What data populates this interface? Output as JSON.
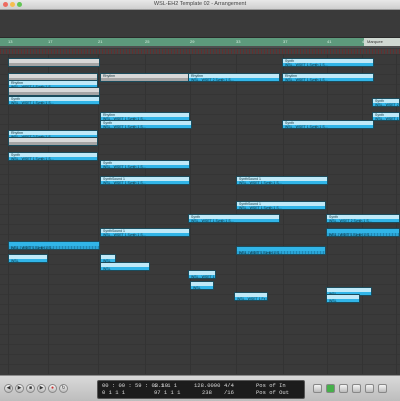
{
  "window": {
    "title": "WSL-EH2 Template 02 - Arrangement"
  },
  "ruler": {
    "bars": [
      "13",
      "17",
      "21",
      "25",
      "29",
      "33",
      "37",
      "41",
      "45",
      "49"
    ],
    "marquee_label": "Marquee"
  },
  "regions": [
    {
      "name": "",
      "body": "",
      "style": "grey"
    },
    {
      "name": "",
      "body": "",
      "style": "grey"
    },
    {
      "name": "Rhythm",
      "body": "WSL - WSET 1 Synth 1 S...",
      "style": "blue"
    },
    {
      "name": "",
      "body": "",
      "style": "grey"
    },
    {
      "name": "Rhythm",
      "body": "",
      "style": "grey"
    },
    {
      "name": "Rhythm",
      "body": "WSL - WSET 2 Synth 1 S...",
      "style": "blue"
    },
    {
      "name": "Rhythm",
      "body": "WSL - WSET 1 Synth 1 S...",
      "style": "blue"
    },
    {
      "name": "Synth",
      "body": "WSL - WSET 1 Synth 1 S...",
      "style": "blue"
    },
    {
      "name": "Synth",
      "body": "WSL - WSET 1 Synth 1 S...",
      "style": "blue"
    },
    {
      "name": "Rhythm",
      "body": "WSL - WSET 2 Synth 1 S...",
      "style": "blue"
    },
    {
      "name": "",
      "body": "",
      "style": "grey"
    },
    {
      "name": "Synth",
      "body": "WSL - WSET 1 Synth 1 S...",
      "style": "blue"
    },
    {
      "name": "Rhythm",
      "body": "WSL - WSET 1 Synth 1 S...",
      "style": "blue"
    },
    {
      "name": "Synth",
      "body": "WSL - WSET 1 Synth 1 S...",
      "style": "blue"
    },
    {
      "name": "Synth",
      "body": "WSL - WSET 1 Synth 1 S...",
      "style": "blue"
    },
    {
      "name": "Synth",
      "body": "WSL - WSET 2 Synth 1 S...",
      "style": "blue"
    },
    {
      "name": "Synth",
      "body": "WSL - WSET 1 Synth 1 S...",
      "style": "blue"
    },
    {
      "name": "Synth",
      "body": "WSL - WSET 1 Synth 1 S...",
      "style": "blue"
    },
    {
      "name": "SynthSound 1",
      "body": "WSL - WSET 1 Synth 1 S...",
      "style": "blue"
    },
    {
      "name": "SynthSound 1",
      "body": "WSL - WSET 1 Synth 1 S...",
      "style": "blue"
    },
    {
      "name": "SynthSound 1",
      "body": "WSL - WSET 1 Synth 1 S...",
      "style": "blue"
    },
    {
      "name": "SynthSound 1",
      "body": "WSL - WSET 1 Synth 1 S...",
      "style": "blue"
    },
    {
      "name": "Synth",
      "body": "WSL - WSET 1 Synth 1 S...",
      "style": "blue"
    },
    {
      "name": "Synth",
      "body": "WSL - WSET 2 Synth 1 S...",
      "style": "blue"
    },
    {
      "name": "",
      "body": "WSL - WSET 1 Synth 1 S...",
      "style": "midi"
    },
    {
      "name": "",
      "body": "WSL - WSET 1 Synth 1 S...",
      "style": "midi"
    },
    {
      "name": "",
      "body": "WSL - WSET 1 Synth 1 S...",
      "style": "midi"
    },
    {
      "name": "",
      "body": "WSL",
      "style": "blue"
    },
    {
      "name": "",
      "body": "WSL",
      "style": "blue"
    },
    {
      "name": "",
      "body": "WSL",
      "style": "blue"
    },
    {
      "name": "",
      "body": "WSL - WSET 1 Fx 2 S...",
      "style": "blue"
    },
    {
      "name": "",
      "body": "WSL",
      "style": "blue"
    },
    {
      "name": "",
      "body": "WSL - WSET 1 Fx 4 S...",
      "style": "blue"
    },
    {
      "name": "",
      "body": "WSL",
      "style": "blue"
    },
    {
      "name": "",
      "body": "WSL",
      "style": "blue"
    }
  ],
  "transport": {
    "smpte": "00 : 00 : 59 : 03.10",
    "subframes": "0   1   1   1",
    "bars_top": "1   1   1   1",
    "bars_bottom": "97   1   1   1",
    "tempo": "128.0000",
    "tempo_sub": "238",
    "sig": "4/4",
    "div": "/16",
    "in_label": "Pos of In",
    "out_label": "Pos of Out"
  }
}
